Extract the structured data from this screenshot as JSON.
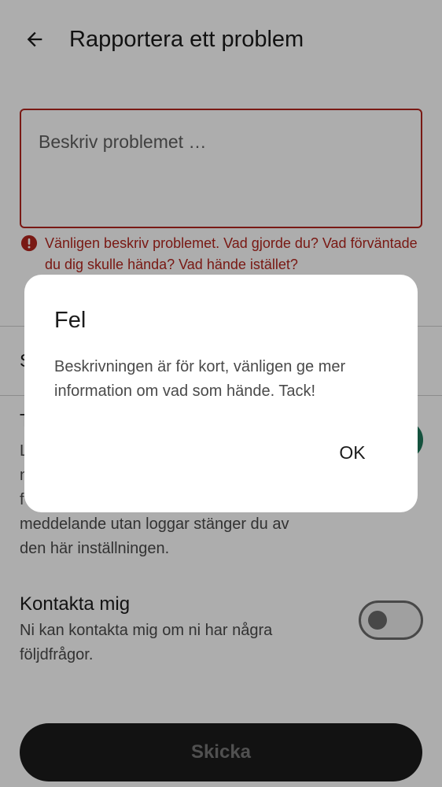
{
  "appbar": {
    "title": "Rapportera ett problem",
    "back_icon": "arrow-back-icon"
  },
  "description": {
    "placeholder": "Beskriv problemet …",
    "value": "",
    "error_text": "Vänligen beskriv problemet. Vad gjorde du? Vad förväntade du dig skulle hända? Vad hände istället?",
    "error_color": "#b3261e"
  },
  "screenshot": {
    "label": "S"
  },
  "logs": {
    "title": "T",
    "description": "L\nn\nf\nmeddelande utan loggar stänger du av\nden här inställningen.",
    "enabled": true,
    "accent_color": "#1f7a5c"
  },
  "contact": {
    "title": "Kontakta mig",
    "description": "Ni kan kontakta mig om ni har några följdfrågor.",
    "enabled": false
  },
  "submit": {
    "label": "Skicka"
  },
  "dialog": {
    "title": "Fel",
    "message": "Beskrivningen är för kort, vänligen ge mer information om vad som hände. Tack!",
    "ok_label": "OK"
  }
}
